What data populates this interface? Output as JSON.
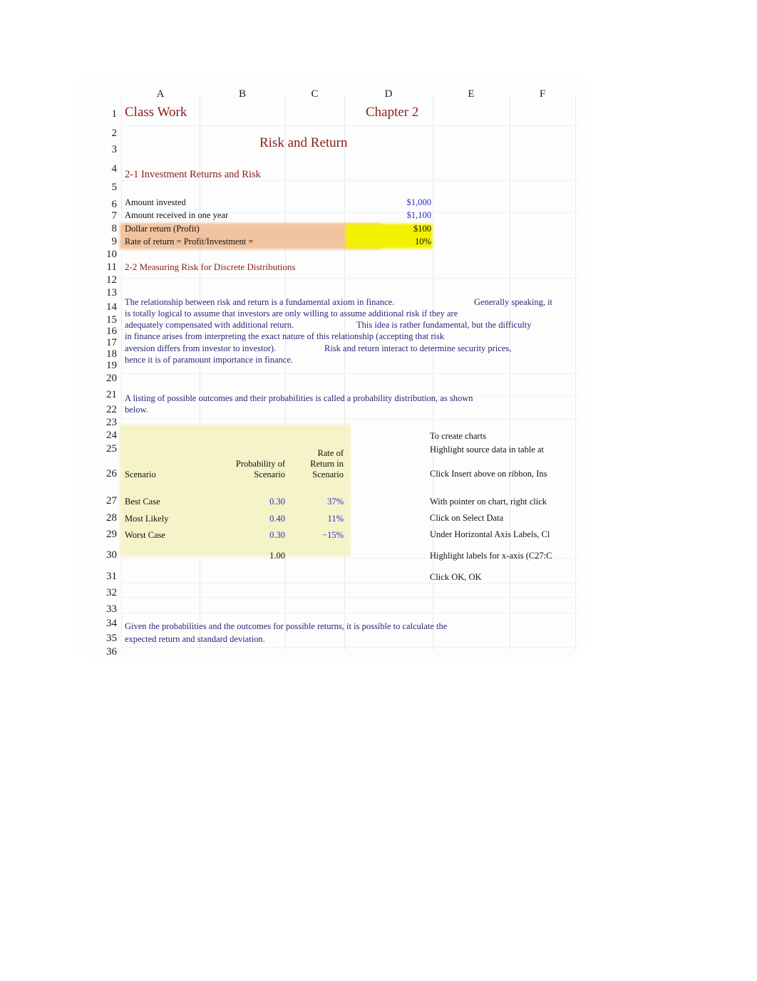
{
  "sheet": {
    "column_headers": [
      "A",
      "B",
      "C",
      "D",
      "E",
      "F"
    ],
    "row_numbers": [
      "1",
      "2",
      "3",
      "4",
      "5",
      "6",
      "7",
      "8",
      "9",
      "10",
      "11",
      "12",
      "13",
      "14",
      "15",
      "16",
      "17",
      "18",
      "19",
      "20",
      "21",
      "22",
      "23",
      "24",
      "25",
      "26",
      "27",
      "28",
      "29",
      "30",
      "31",
      "32",
      "33",
      "34",
      "35",
      "36"
    ],
    "colors": {
      "title_maroon": "#8b1a1a",
      "value_blue": "#2a2ad0",
      "body_navy": "#26267a",
      "highlight_orange": "#f2c09a",
      "highlight_yellow": "#f2f200",
      "table_cream": "#f5f3c8"
    }
  },
  "titles": {
    "class_work": "Class Work",
    "chapter": "Chapter 2",
    "risk_and_return": "Risk and Return",
    "section_2_1": "2-1 Investment Returns and Risk",
    "section_2_2": "2-2 Measuring Risk for Discrete Distributions"
  },
  "investment": {
    "rows": [
      {
        "label": "Amount invested",
        "value": "$1,000",
        "value_color": "blue"
      },
      {
        "label": "Amount received in one year",
        "value": "$1,100",
        "value_color": "blue"
      },
      {
        "label": "Dollar return (Profit)",
        "value": "$100",
        "value_color": "black"
      },
      {
        "label": "Rate of return = Profit/Investment =",
        "value": "10%",
        "value_color": "black"
      }
    ]
  },
  "paragraph_1": {
    "lines": [
      {
        "left": "The relationship between risk and return is a fundamental axiom in finance.",
        "right": "Generally speaking, it"
      },
      {
        "left": "is totally logical to assume that investors are only willing to assume additional risk if they are",
        "right": ""
      },
      {
        "left": "adequately compensated with additional return.",
        "right": "This idea is rather fundamental, but the difficulty"
      },
      {
        "left": "in finance arises from interpreting the exact nature of this relationship (accepting that risk",
        "right": ""
      },
      {
        "left": "aversion differs from investor to investor).",
        "right": "Risk and return interact to determine security prices,"
      },
      {
        "left": "hence it is of paramount importance in finance.",
        "right": ""
      }
    ]
  },
  "paragraph_2": {
    "lines": [
      "A listing of possible outcomes and their probabilities is called a probability distribution, as shown",
      "below."
    ]
  },
  "paragraph_3": {
    "lines": [
      "Given the probabilities and the outcomes for possible returns, it is possible to calculate the",
      "expected return and standard deviation."
    ]
  },
  "scenario_table": {
    "headers": {
      "scenario": "Scenario",
      "probability_line1": "Probability of",
      "probability_line2": "Scenario",
      "rate_line1": "Rate of",
      "rate_line2": "Return in",
      "rate_line3": "Scenario"
    },
    "rows": [
      {
        "scenario": "Best Case",
        "probability": "0.30",
        "rate": "37%"
      },
      {
        "scenario": "Most Likely",
        "probability": "0.40",
        "rate": "11%"
      },
      {
        "scenario": "Worst Case",
        "probability": "0.30",
        "rate": "−15%"
      }
    ],
    "total": {
      "scenario": "",
      "probability": "1.00",
      "rate": ""
    }
  },
  "instructions": {
    "lines": [
      "To create charts",
      "Highlight source data in table at",
      "Click Insert above on ribbon, Ins",
      "With pointer on chart, right click",
      "Click on Select Data",
      "Under Horizontal Axis Labels, Cl",
      "Highlight labels for x-axis (C27:C",
      "Click OK, OK"
    ]
  }
}
